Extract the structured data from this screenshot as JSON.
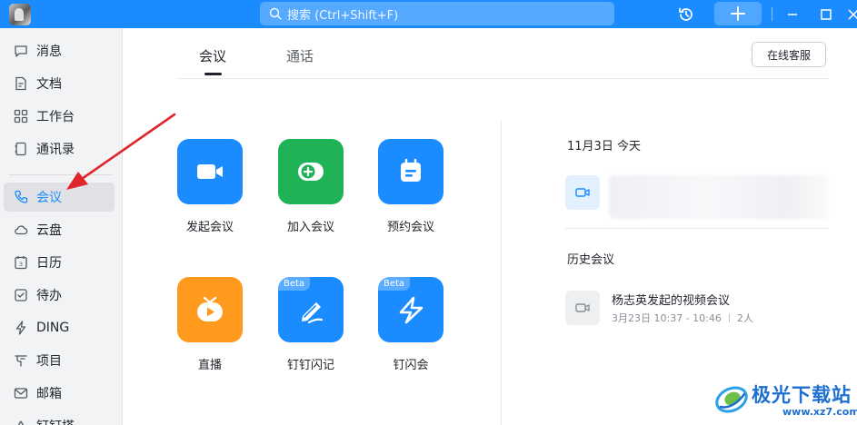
{
  "titlebar": {
    "search_placeholder": "搜索 (Ctrl+Shift+F)",
    "accent_color": "#1a8cff"
  },
  "sidebar": {
    "items": [
      {
        "label": "消息",
        "icon": "message-icon"
      },
      {
        "label": "文档",
        "icon": "document-icon"
      },
      {
        "label": "工作台",
        "icon": "workbench-icon"
      },
      {
        "label": "通讯录",
        "icon": "contacts-icon"
      },
      {
        "label": "会议",
        "icon": "phone-icon",
        "active": true
      },
      {
        "label": "云盘",
        "icon": "cloud-icon"
      },
      {
        "label": "日历",
        "icon": "calendar-icon"
      },
      {
        "label": "待办",
        "icon": "todo-icon"
      },
      {
        "label": "DING",
        "icon": "ding-icon"
      },
      {
        "label": "项目",
        "icon": "project-icon"
      },
      {
        "label": "邮箱",
        "icon": "mail-icon"
      },
      {
        "label": "钉钉搭",
        "icon": "build-icon"
      }
    ]
  },
  "main": {
    "tabs": [
      {
        "label": "会议",
        "active": true
      },
      {
        "label": "通话",
        "active": false
      }
    ],
    "support_button": "在线客服",
    "tiles": [
      {
        "label": "发起会议",
        "icon": "video-camera-icon",
        "color": "#1a8cff"
      },
      {
        "label": "加入会议",
        "icon": "join-plus-icon",
        "color": "#1fb256"
      },
      {
        "label": "预约会议",
        "icon": "calendar-icon",
        "color": "#1a8cff"
      },
      {
        "label": "直播",
        "icon": "live-tv-icon",
        "color": "#ff9a1f"
      },
      {
        "label": "钉钉闪记",
        "icon": "pen-note-icon",
        "color": "#1a8cff",
        "badge": "Beta"
      },
      {
        "label": "钉闪会",
        "icon": "lightning-icon",
        "color": "#1a8cff",
        "badge": "Beta"
      }
    ]
  },
  "right_panel": {
    "date_label": "11月3日 今天",
    "history_title": "历史会议",
    "history_items": [
      {
        "title": "杨志英发起的视频会议",
        "time": "3月23日 10:37 - 10:46",
        "participants": "2人"
      }
    ]
  },
  "watermark": {
    "title": "极光下载站",
    "url": "www.xz7.com"
  }
}
